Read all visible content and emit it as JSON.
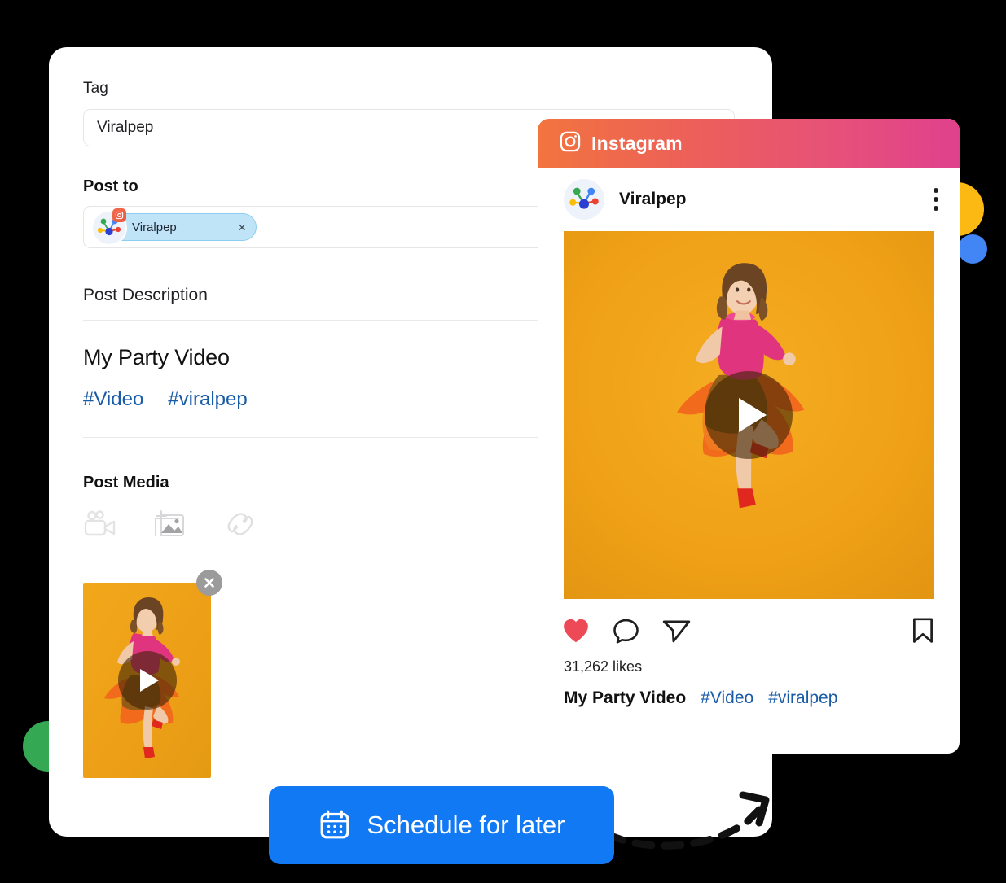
{
  "composer": {
    "tag": {
      "label": "Tag",
      "value": "Viralpep",
      "placeholder": "Viralpep"
    },
    "post_to": {
      "label": "Post to",
      "chip_name": "Viralpep",
      "chip_remove_label": "×",
      "chip_network": "instagram"
    },
    "post_description": {
      "label": "Post Description",
      "title": "My Party Video",
      "hashtags": [
        "#Video",
        "#viralpep"
      ]
    },
    "post_media": {
      "label": "Post Media",
      "icons": [
        "video-camera-icon",
        "add-image-icon",
        "link-icon"
      ],
      "thumbnail_alt": "My Party Video thumbnail",
      "thumbnail_remove_label": "remove"
    }
  },
  "instagram_preview": {
    "header_title": "Instagram",
    "header_icon": "instagram-icon",
    "author_name": "Viralpep",
    "menu_icon": "more-vertical-icon",
    "actions": [
      "heart-icon",
      "comment-icon",
      "share-icon",
      "bookmark-icon"
    ],
    "likes": "31,262 likes",
    "caption_title": "My Party Video",
    "caption_hashtags": [
      "#Video",
      "#viralpep"
    ]
  },
  "schedule_button": {
    "label": "Schedule for later",
    "icon": "calendar-icon"
  },
  "colors": {
    "accent_blue": "#1279f5",
    "hashtag_blue": "#1a5ba8",
    "heart_red": "#ed4956",
    "instagram_gradient_start": "#f2743f",
    "instagram_gradient_end": "#e0418d",
    "deco_yellow": "#fdb913",
    "deco_blue": "#4285f4",
    "deco_green": "#34a853",
    "chip_background": "#bfe4f8",
    "photo_background": "#f0a116"
  }
}
